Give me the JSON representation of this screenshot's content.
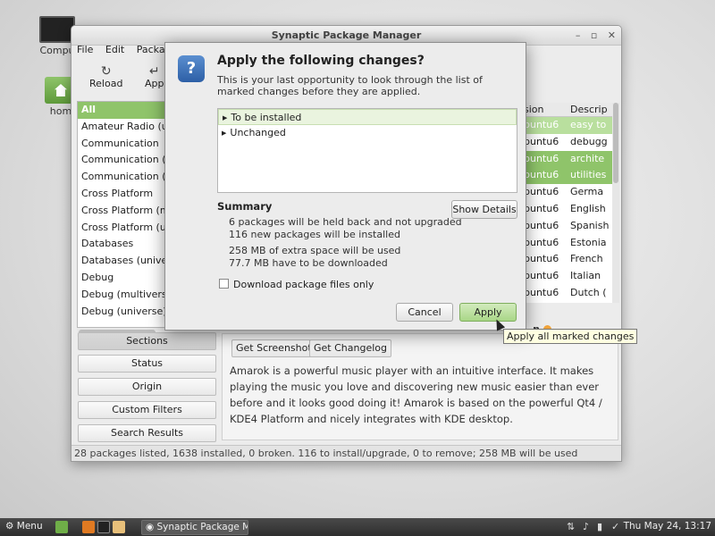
{
  "desktop": {
    "icons": [
      {
        "label": "Compu"
      },
      {
        "label": "hom"
      }
    ]
  },
  "window": {
    "title": "Synaptic Package Manager",
    "controls": [
      "–",
      "▫",
      "✕"
    ],
    "menu": [
      "File",
      "Edit",
      "Packa"
    ],
    "toolbar": {
      "reload_label": "Reload",
      "apply_label": "App"
    },
    "sidebar": {
      "items": [
        "All",
        "Amateur Radio (uni",
        "Communication",
        "Communication (m",
        "Communication (u",
        "Cross Platform",
        "Cross Platform (m",
        "Cross Platform (un",
        "Databases",
        "Databases (univer",
        "Debug",
        "Debug (multiverse",
        "Debug (universe)"
      ]
    },
    "filter_buttons": [
      "Sections",
      "Status",
      "Origin",
      "Custom Filters",
      "Search Results"
    ],
    "package_list": {
      "columns": [
        "sion",
        "Descrip"
      ],
      "rows": [
        {
          "version": "buntu6",
          "desc": "easy to"
        },
        {
          "version": "buntu6",
          "desc": "debugg"
        },
        {
          "version": "buntu6",
          "desc": "archite"
        },
        {
          "version": "buntu6",
          "desc": "utilities"
        },
        {
          "version": "buntu6",
          "desc": "Germa"
        },
        {
          "version": "buntu6",
          "desc": "English"
        },
        {
          "version": "buntu6",
          "desc": "Spanish"
        },
        {
          "version": "buntu6",
          "desc": "Estonia"
        },
        {
          "version": "buntu6",
          "desc": "French"
        },
        {
          "version": "buntu6",
          "desc": "Italian"
        },
        {
          "version": "buntu6",
          "desc": "Dutch ("
        }
      ]
    },
    "details": {
      "badge": "n",
      "get_screenshot": "Get Screenshot",
      "get_changelog": "Get Changelog",
      "description": "Amarok is a powerful music player with an intuitive interface. It makes playing the music you love and discovering new music easier than ever before and it looks good doing it! Amarok is based on the powerful Qt4 / KDE4 Platform and nicely integrates with KDE desktop."
    },
    "statusbar": "28 packages listed, 1638 installed, 0 broken. 116 to install/upgrade, 0 to remove; 258 MB will be used"
  },
  "dialog": {
    "icon_glyph": "?",
    "title": "Apply the following changes?",
    "description": "This is your last opportunity to look through the list of marked changes before they are applied.",
    "changes": [
      "To be installed",
      "Unchanged"
    ],
    "summary_title": "Summary",
    "summary_lines": [
      "6 packages will be held back and not upgraded",
      "116 new packages will be installed",
      "258 MB of extra space will be used",
      "77.7 MB have to be downloaded"
    ],
    "show_details": "Show Details",
    "download_only": "Download package files only",
    "cancel": "Cancel",
    "apply": "Apply"
  },
  "tooltip": "Apply all marked changes",
  "taskbar": {
    "menu_label": "Menu",
    "window_label": "Synaptic Package M...",
    "clock": "Thu May 24, 13:17"
  },
  "colors": {
    "accent_green": "#8fc46a",
    "selection_light": "#eaf4df",
    "tooltip_bg": "#ffffe1"
  }
}
